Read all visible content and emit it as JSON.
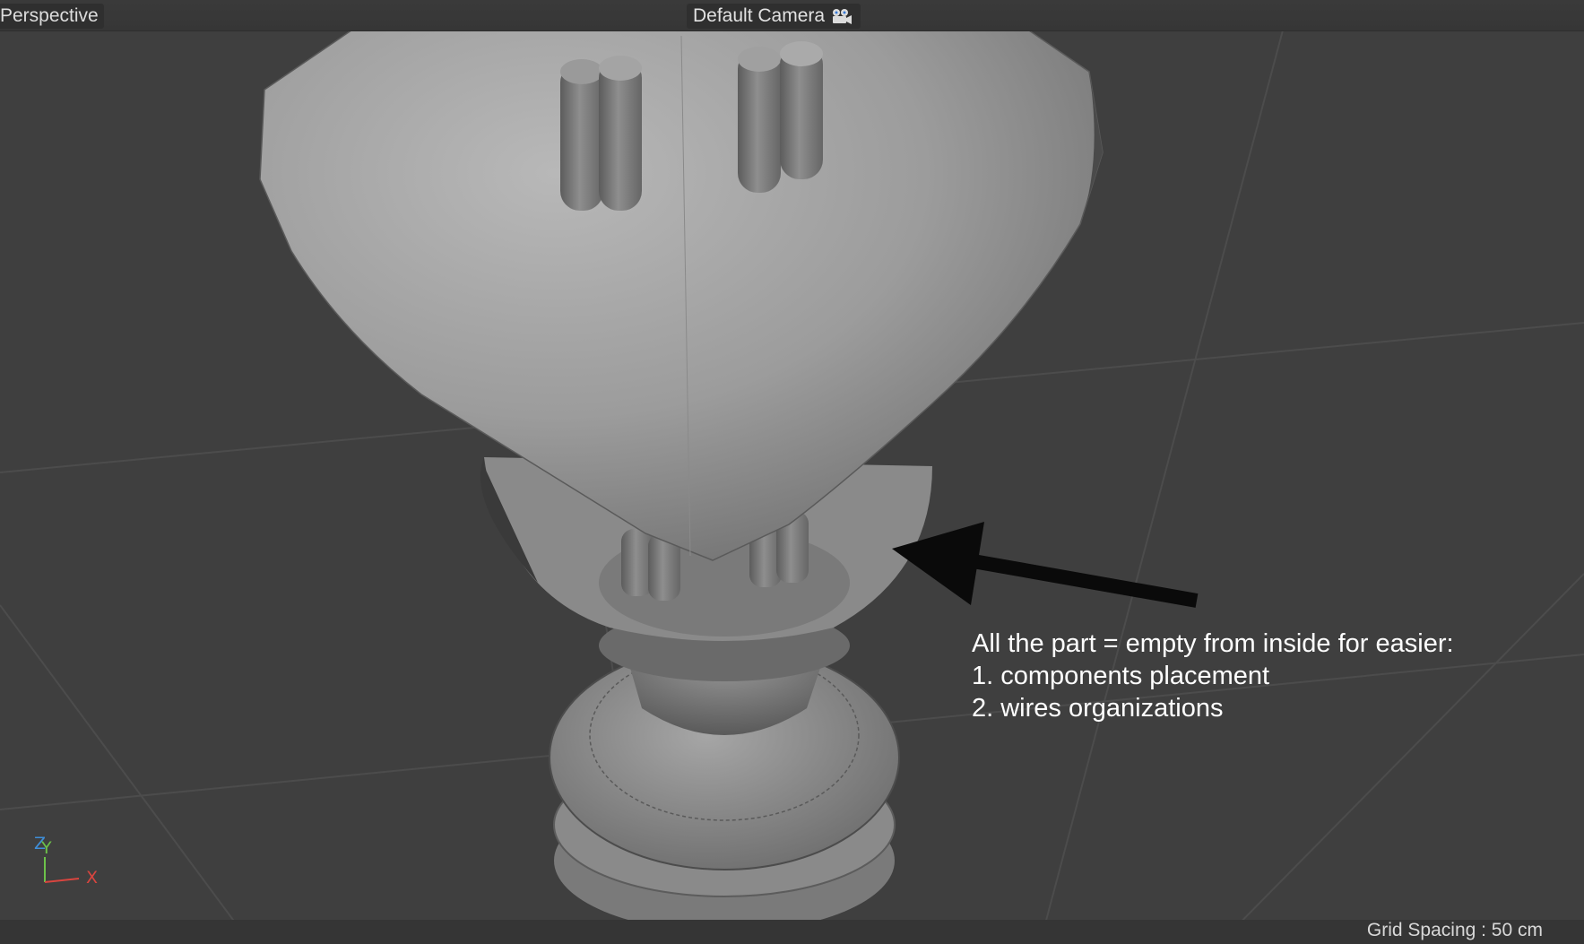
{
  "viewport": {
    "view_label": "Perspective",
    "camera_label": "Default Camera",
    "camera_icon": "camera-icon",
    "grid_spacing": "Grid Spacing : 50 cm",
    "axis": {
      "z": "Z",
      "y": "Y",
      "x": "X"
    },
    "colors": {
      "background": "#3f3f3f",
      "axis_x": "#d9453f",
      "axis_y": "#6cc24a",
      "axis_z": "#3f8fd9"
    }
  },
  "annotation": {
    "lines": [
      "All the part = empty from inside for easier:",
      "1. components placement",
      "2. wires organizations"
    ]
  }
}
